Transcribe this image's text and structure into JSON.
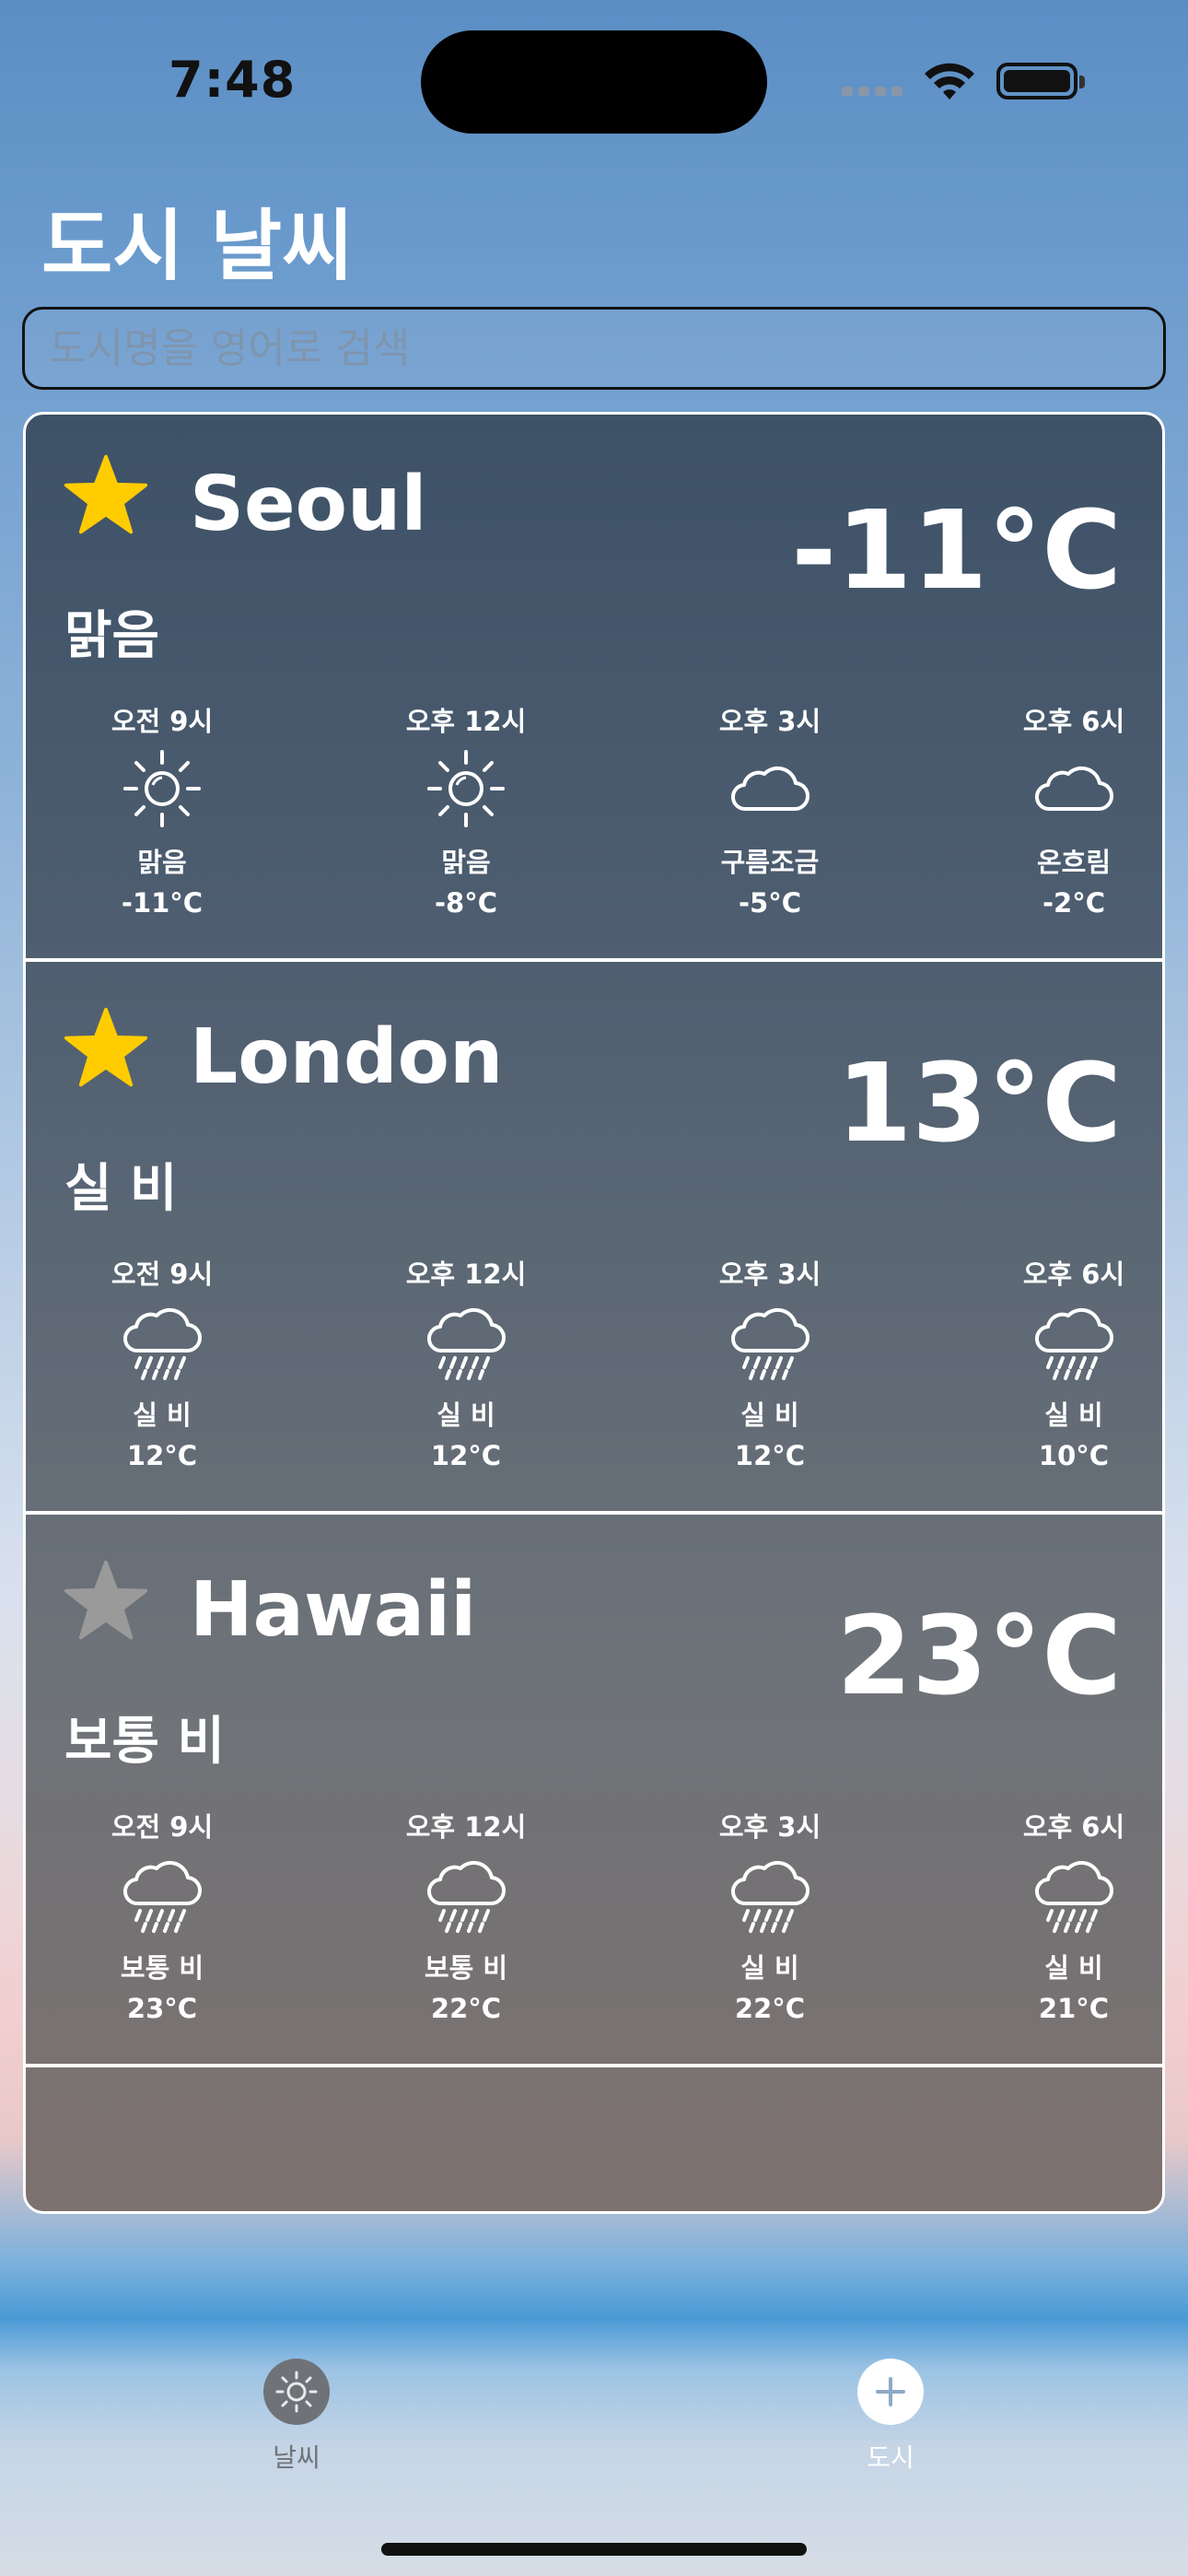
{
  "status": {
    "time": "7:48"
  },
  "header": {
    "title": "도시 날씨"
  },
  "search": {
    "placeholder": "도시명을 영어로 검색"
  },
  "colors": {
    "favorite": "#FFCC00",
    "not_favorite": "#9A9A9A"
  },
  "cities": [
    {
      "name": "Seoul",
      "temp": "-11°C",
      "condition": "맑음",
      "favorite": true,
      "hours": [
        {
          "time": "오전 9시",
          "icon": "sun-icon",
          "condition": "맑음",
          "temp": "-11°C"
        },
        {
          "time": "오후 12시",
          "icon": "sun-icon",
          "condition": "맑음",
          "temp": "-8°C"
        },
        {
          "time": "오후 3시",
          "icon": "cloud-icon",
          "condition": "구름조금",
          "temp": "-5°C"
        },
        {
          "time": "오후 6시",
          "icon": "cloud-icon",
          "condition": "온흐림",
          "temp": "-2°C"
        }
      ]
    },
    {
      "name": "London",
      "temp": "13°C",
      "condition": "실 비",
      "favorite": true,
      "hours": [
        {
          "time": "오전 9시",
          "icon": "rain-icon",
          "condition": "실 비",
          "temp": "12°C"
        },
        {
          "time": "오후 12시",
          "icon": "rain-icon",
          "condition": "실 비",
          "temp": "12°C"
        },
        {
          "time": "오후 3시",
          "icon": "rain-icon",
          "condition": "실 비",
          "temp": "12°C"
        },
        {
          "time": "오후 6시",
          "icon": "rain-icon",
          "condition": "실 비",
          "temp": "10°C"
        }
      ]
    },
    {
      "name": "Hawaii",
      "temp": "23°C",
      "condition": "보통 비",
      "favorite": false,
      "hours": [
        {
          "time": "오전 9시",
          "icon": "rain-icon",
          "condition": "보통 비",
          "temp": "23°C"
        },
        {
          "time": "오후 12시",
          "icon": "rain-icon",
          "condition": "보통 비",
          "temp": "22°C"
        },
        {
          "time": "오후 3시",
          "icon": "rain-icon",
          "condition": "실 비",
          "temp": "22°C"
        },
        {
          "time": "오후 6시",
          "icon": "rain-icon",
          "condition": "실 비",
          "temp": "21°C"
        }
      ]
    }
  ],
  "tabbar": {
    "items": [
      {
        "label": "날씨",
        "icon": "sun-icon",
        "selected": false
      },
      {
        "label": "도시",
        "icon": "plus-icon",
        "selected": true
      }
    ]
  }
}
